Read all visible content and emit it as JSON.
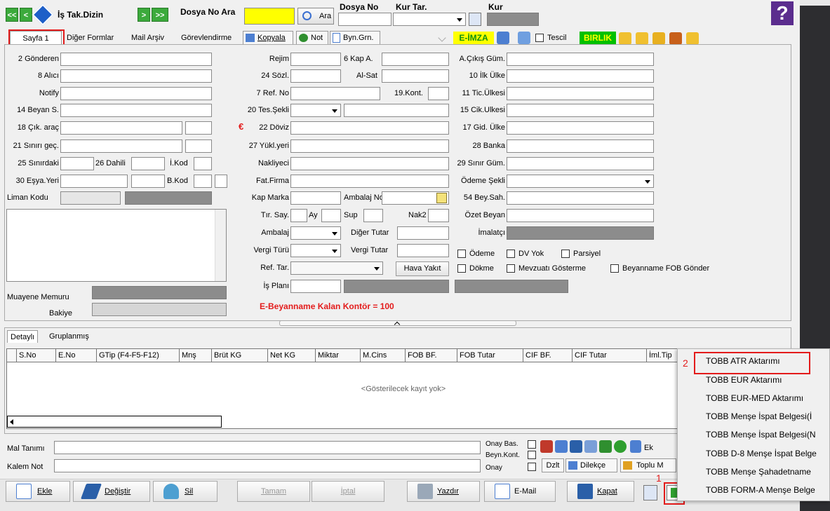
{
  "toolbar": {
    "is_tak_dizin": "İş Tak.Dizin",
    "dosya_no_ara": "Dosya No Ara",
    "ara_btn": "Ara",
    "dosya_no_label": "Dosya No",
    "kur_tar_label": "Kur Tar.",
    "kur_label": "Kur",
    "help": "?"
  },
  "tabs": {
    "sayfa1": "Sayfa 1",
    "diger_formlar": "Diğer Formlar",
    "mail_arsiv": "Mail Arşiv",
    "gorevlendirme": "Görevlendirme",
    "kopyala": "Kopyala",
    "not": "Not",
    "byn_grn": "Byn.Grn.",
    "e_imza": "E-İMZA",
    "tescil": "Tescil",
    "birlik": "BIRLIK"
  },
  "form_left": {
    "gonderen": "2 Gönderen",
    "alici": "8 Alıcı",
    "notify": "Notify",
    "beyan": "14 Beyan S.",
    "cik_arac": "18 Çık. araç",
    "siniri_gec": "21 Sınırı geç.",
    "sinirdaki": "25 Sınırdaki",
    "dahili": "26 Dahili",
    "i_kod": "İ.Kod",
    "esya_yeri": "30 Eşya.Yeri",
    "b_kod": "B.Kod",
    "liman_kodu": "Liman Kodu",
    "muayene_memuru": "Muayene Memuru",
    "bakiye": "Bakiye"
  },
  "form_mid": {
    "rejim": "Rejim",
    "kap_a": "6 Kap A.",
    "sozl": "24 Sözl.",
    "al_sat": "Al-Sat",
    "ref_no": "7 Ref. No",
    "kont": "19.Kont.",
    "tes_sekli": "20 Tes.Şekli",
    "doviz": "22 Döviz",
    "euro": "€",
    "yukl_yeri": "27 Yükl.yeri",
    "nakliyeci": "Nakliyeci",
    "fat_firma": "Fat.Firma",
    "kap_marka": "Kap Marka",
    "ambalaj_no": "Ambalaj No",
    "tir_say": "Tır. Say.",
    "ay": "Ay",
    "sup": "Sup",
    "nak2": "Nak2",
    "ambalaj": "Ambalaj",
    "diger_tutar": "Diğer Tutar",
    "vergi_turu": "Vergi Türü",
    "vergi_tutar": "Vergi Tutar",
    "ref_tar": "Ref. Tar.",
    "hava_yakit": "Hava Yakıt",
    "is_plani": "İş Planı",
    "kontor": "E-Beyanname Kalan Kontör = 100"
  },
  "form_right": {
    "a_cikis_gum": "A.Çıkış Güm.",
    "ilk_ulke": "10 İlk Ülke",
    "tic_ulkesi": "11 Tic.Ülkesi",
    "cik_ulkesi": "15 Cik.Ulkesi",
    "gid_ulke": "17 Gid. Ülke",
    "banka": "28 Banka",
    "sinir_gum": "29 Sınır Güm.",
    "odeme_sekli": "Ödeme Şekli",
    "bey_sah": "54 Bey.Sah.",
    "ozet_beyan": "Özet Beyan",
    "imalatci": "İmalatçı",
    "odeme": "Ödeme",
    "dv_yok": "DV Yok",
    "parsiyel": "Parsiyel",
    "dokme": "Dökme",
    "mevzuati_gosterme": "Mevzuatı Gösterme",
    "fob_gonder": "Beyanname FOB Gönder"
  },
  "detail": {
    "tab_detayli": "Detaylı",
    "tab_gruplanmis": "Gruplanmış",
    "columns": [
      "S.No",
      "E.No",
      "GTip (F4-F5-F12)",
      "Mnş",
      "Brüt KG",
      "Net KG",
      "Miktar",
      "M.Cins",
      "FOB BF.",
      "FOB Tutar",
      "CIF BF.",
      "CIF Tutar",
      "İml.Tip"
    ],
    "empty": "<Gösterilecek kayıt yok>"
  },
  "bottom": {
    "mal_tanimi": "Mal Tanımı",
    "kalem_not": "Kalem Not",
    "onay_bas": "Onay Bas.",
    "beyn_kont": "Beyn.Kont.",
    "onay": "Onay",
    "dzlt": "Dzlt",
    "dilekce": "Dilekçe",
    "toplu_m": "Toplu M",
    "ek": "Ek"
  },
  "buttons": {
    "ekle": "Ekle",
    "degistir": "Değiştir",
    "sil": "Sil",
    "tamam": "Tamam",
    "iptal": "İptal",
    "yazdir": "Yazdır",
    "email": "E-Mail",
    "kapat": "Kapat"
  },
  "context_menu": [
    "TOBB ATR Aktarımı",
    "TOBB EUR Aktarımı",
    "TOBB EUR-MED Aktarımı",
    "TOBB Menşe İspat Belgesi(İ",
    "TOBB Menşe İspat Belgesi(N",
    "TOBB D-8 Menşe İspat Belge",
    "TOBB Menşe Şahadetname",
    "TOBB FORM-A Menşe Belge"
  ],
  "annotations": {
    "one": "1",
    "two": "2"
  },
  "colors": {
    "accent_red": "#e31b1b",
    "search_yellow": "#ffff00",
    "green_button": "#3caa3c",
    "eimza_bg": "#ffff00",
    "birlik_bg": "#00c000"
  }
}
